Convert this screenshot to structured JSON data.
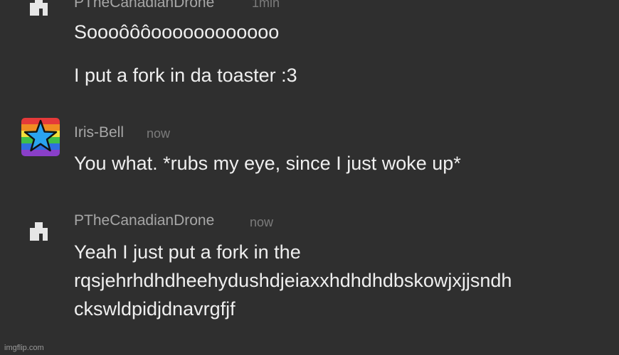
{
  "messages": [
    {
      "username": "PTheCanadianDrone",
      "time": "1min",
      "avatar_icon": "robot-silhouette-icon",
      "lines": [
        "Soooôôôoooooooooooo",
        "I put a fork in da toaster :3"
      ]
    },
    {
      "username": "Iris-Bell",
      "time": "now",
      "avatar_icon": "rainbow-star-icon",
      "lines": [
        "You what. *rubs my eye, since I just woke up*"
      ]
    },
    {
      "username": "PTheCanadianDrone",
      "time": "now",
      "avatar_icon": "robot-silhouette-icon",
      "lines": [
        "Yeah I just put a fork in the",
        "rqsjehrhdhdheehydushdjeiaxxhdhdhdbskowjxjjsndh",
        "ckswldpidjdnavrgfjf"
      ]
    }
  ],
  "watermark": "imgflip.com",
  "colors": {
    "background": "#2f2f2f",
    "username": "#a7a7a7",
    "timestamp": "#7c7c7c",
    "message_text": "#efefef",
    "star_fill": "#2aa4ef"
  }
}
